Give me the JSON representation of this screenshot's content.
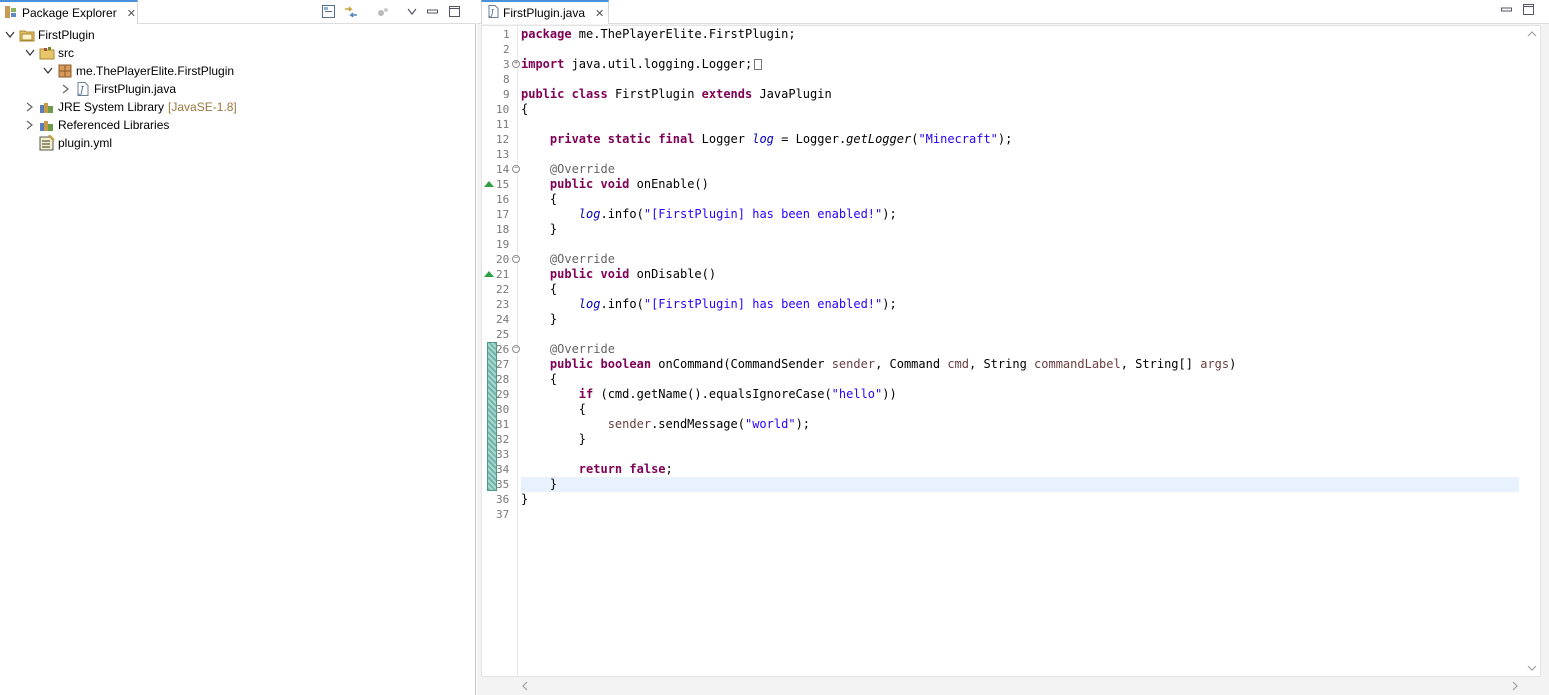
{
  "package_explorer": {
    "tab_label": "Package Explorer",
    "tree": [
      {
        "label": "FirstPlugin",
        "level": 0,
        "chevron": "down",
        "icon": "project-icon"
      },
      {
        "label": "src",
        "level": 1,
        "chevron": "down",
        "icon": "source-folder-icon"
      },
      {
        "label": "me.ThePlayerElite.FirstPlugin",
        "level": 2,
        "chevron": "down",
        "icon": "package-icon"
      },
      {
        "label": "FirstPlugin.java",
        "level": 3,
        "chevron": "right",
        "icon": "java-file-icon"
      },
      {
        "label": "JRE System Library",
        "decoration": "[JavaSE-1.8]",
        "level": 1,
        "chevron": "right",
        "icon": "library-icon"
      },
      {
        "label": "Referenced Libraries",
        "level": 1,
        "chevron": "right",
        "icon": "library-icon"
      },
      {
        "label": "plugin.yml",
        "level": 1,
        "chevron": "none",
        "icon": "yml-file-icon"
      }
    ]
  },
  "editor": {
    "tab_label": "FirstPlugin.java",
    "line_numbers": [
      "1",
      "2",
      "3",
      "8",
      "9",
      "10",
      "11",
      "12",
      "13",
      "14",
      "15",
      "16",
      "17",
      "18",
      "19",
      "20",
      "21",
      "22",
      "23",
      "24",
      "25",
      "26",
      "27",
      "28",
      "29",
      "30",
      "31",
      "32",
      "33",
      "34",
      "35",
      "36",
      "37"
    ],
    "code_lines": [
      "package me.ThePlayerElite.FirstPlugin;",
      "",
      "import java.util.logging.Logger;",
      "",
      "public class FirstPlugin extends JavaPlugin",
      "{",
      "",
      "    private static final Logger log = Logger.getLogger(\"Minecraft\");",
      "",
      "    @Override",
      "    public void onEnable()",
      "    {",
      "        log.info(\"[FirstPlugin] has been enabled!\");",
      "    }",
      "",
      "    @Override",
      "    public void onDisable()",
      "    {",
      "        log.info(\"[FirstPlugin] has been enabled!\");",
      "    }",
      "",
      "    @Override",
      "    public boolean onCommand(CommandSender sender, Command cmd, String commandLabel, String[] args)",
      "    {",
      "        if (cmd.getName().equalsIgnoreCase(\"hello\"))",
      "        {",
      "            sender.sendMessage(\"world\");",
      "        }",
      "",
      "        return false;",
      "    }",
      "}",
      ""
    ]
  },
  "colors": {
    "keyword": "#7f0055",
    "string": "#2a00ff",
    "annotation": "#646464",
    "field": "#0000c0",
    "tab_accent": "#4a90d9",
    "current_line": "#e8f2fe"
  }
}
